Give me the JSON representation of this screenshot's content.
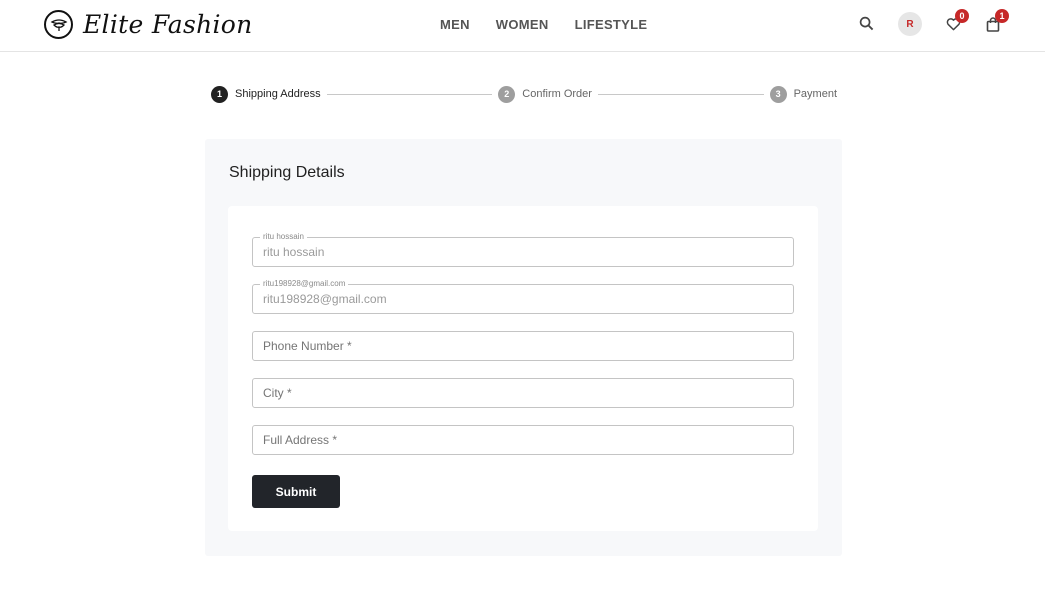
{
  "brand": {
    "name": "Elite Fashion",
    "logo_icon": "logo-emblem-icon"
  },
  "nav": {
    "items": [
      {
        "label": "MEN"
      },
      {
        "label": "WOMEN"
      },
      {
        "label": "LIFESTYLE"
      }
    ]
  },
  "header": {
    "search_icon": "search-icon",
    "avatar_initial": "R",
    "wishlist_count": "0",
    "cart_count": "1"
  },
  "stepper": {
    "steps": [
      {
        "number": "1",
        "label": "Shipping Address",
        "active": true
      },
      {
        "number": "2",
        "label": "Confirm Order",
        "active": false
      },
      {
        "number": "3",
        "label": "Payment",
        "active": false
      }
    ]
  },
  "form": {
    "title": "Shipping Details",
    "fields": [
      {
        "legend": "ritu hossain",
        "value": "ritu hossain",
        "placeholder": ""
      },
      {
        "legend": "ritu198928@gmail.com",
        "value": "ritu198928@gmail.com",
        "placeholder": ""
      },
      {
        "legend": "",
        "value": "",
        "placeholder": "Phone Number *"
      },
      {
        "legend": "",
        "value": "",
        "placeholder": "City *"
      },
      {
        "legend": "",
        "value": "",
        "placeholder": "Full Address *"
      }
    ],
    "submit_label": "Submit"
  },
  "colors": {
    "accent_dark": "#22252a",
    "badge_red": "#c62828",
    "card_bg": "#f7f8fa"
  }
}
